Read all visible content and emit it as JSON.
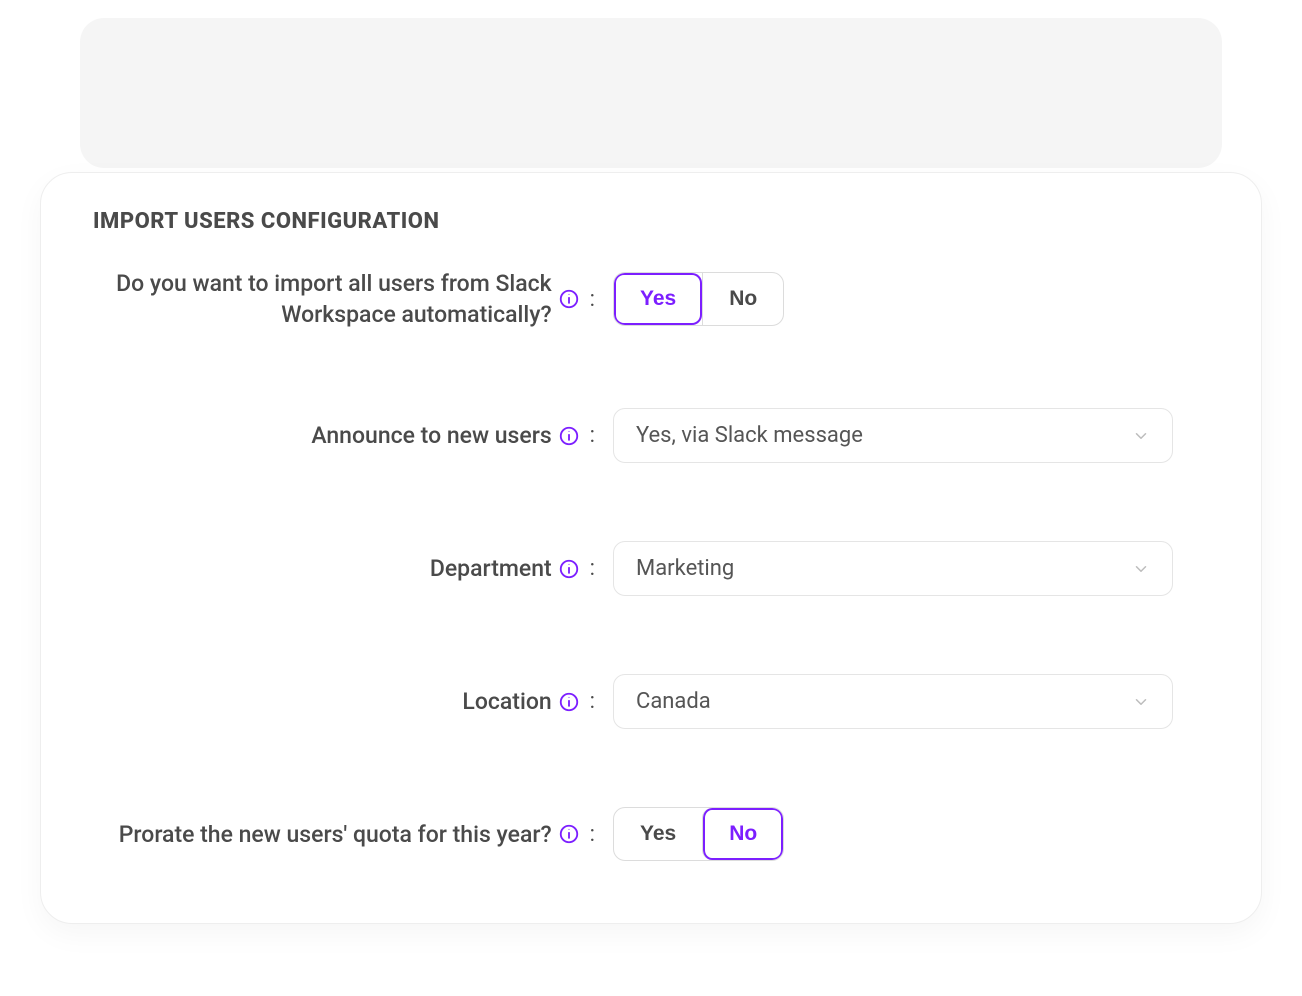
{
  "title": "IMPORT USERS CONFIGURATION",
  "colors": {
    "accent": "#7c1fff"
  },
  "rows": {
    "autoimport": {
      "label": "Do you want to import all users from Slack Workspace automatically?",
      "yes": "Yes",
      "no": "No",
      "selected": "yes"
    },
    "announce": {
      "label": "Announce to new users",
      "value": "Yes, via Slack message"
    },
    "department": {
      "label": "Department",
      "value": "Marketing"
    },
    "location": {
      "label": "Location",
      "value": "Canada"
    },
    "prorate": {
      "label": "Prorate the new users' quota for this year?",
      "yes": "Yes",
      "no": "No",
      "selected": "no"
    }
  }
}
